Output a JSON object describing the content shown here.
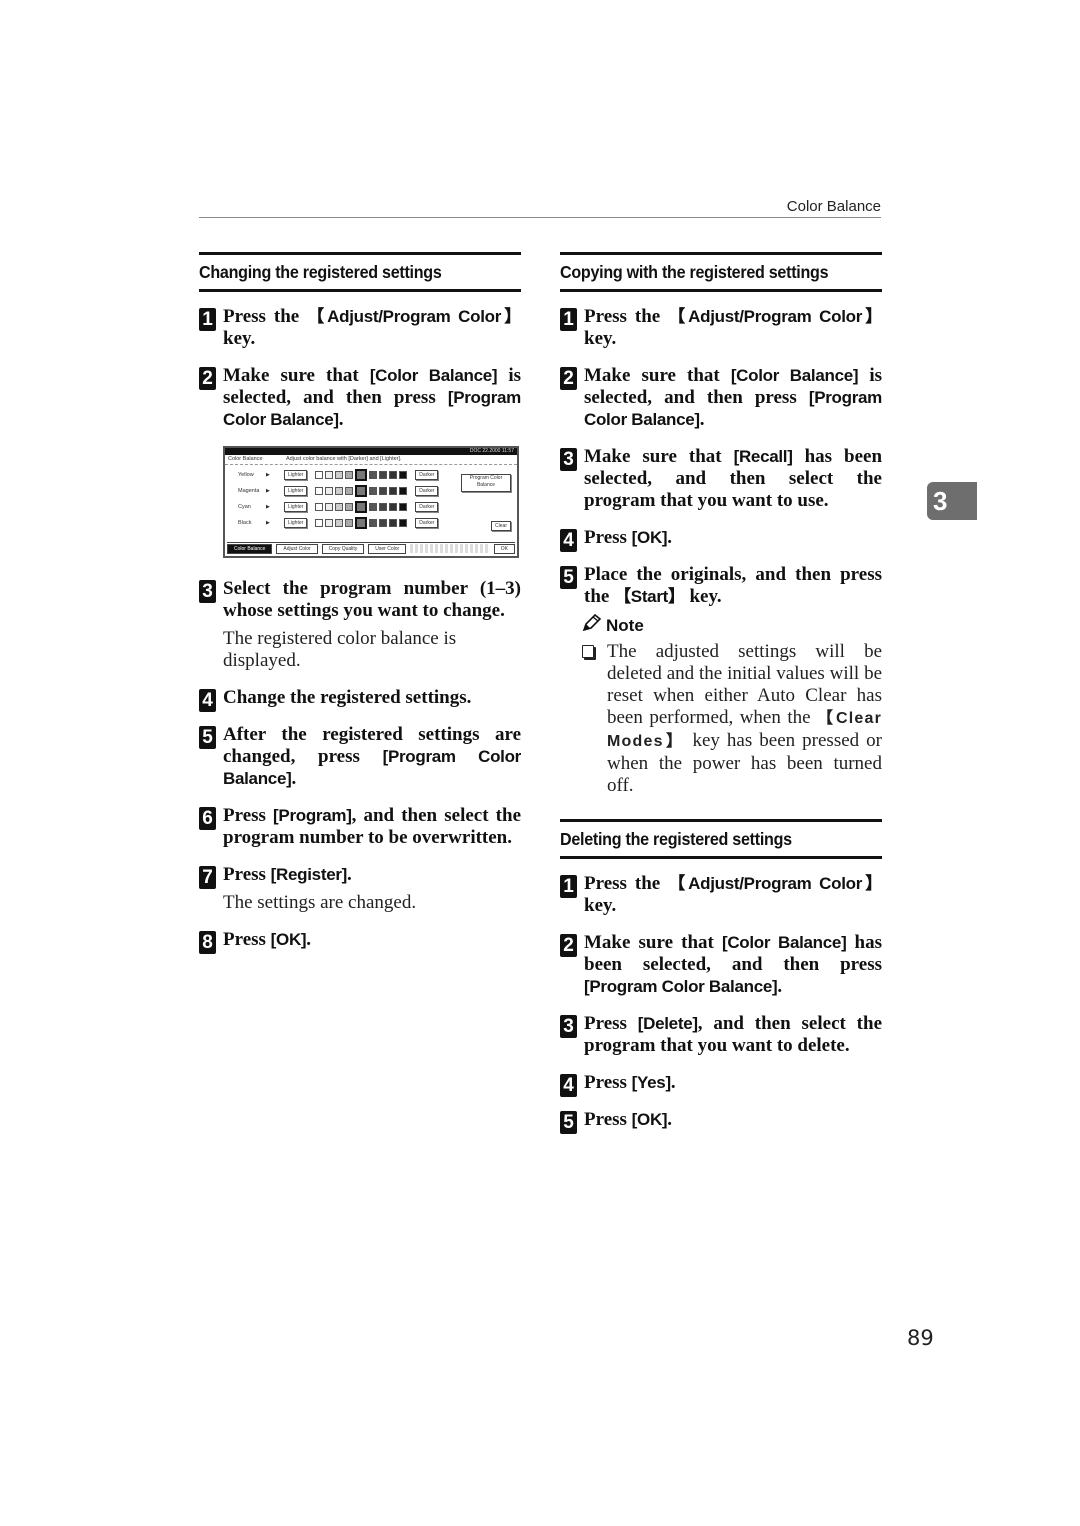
{
  "running_header": "Color Balance",
  "chapter_tab": "3",
  "page_number": "89",
  "left": {
    "heading": "Changing the registered settings",
    "steps": [
      {
        "num": "1",
        "pre": "Press the ",
        "key": "【Adjust/Program Color】",
        "post": " key."
      },
      {
        "num": "2",
        "pre": "Make sure that ",
        "key": "[Color Balance]",
        "mid": " is selected, and then press ",
        "key2": "[Program Color Balance]",
        "post": "."
      },
      {
        "num": "3",
        "text": "Select the program number (1–3) whose settings you want to change.",
        "sub": "The registered color balance is displayed."
      },
      {
        "num": "4",
        "text": "Change the registered settings."
      },
      {
        "num": "5",
        "pre": "After the registered settings are changed, press ",
        "key": "[Program Color Balance]",
        "post": "."
      },
      {
        "num": "6",
        "pre": "Press ",
        "key": "[Program]",
        "post": ", and then select the program number to be overwritten."
      },
      {
        "num": "7",
        "pre": "Press ",
        "key": "[Register]",
        "post": ".",
        "sub": "The settings are changed."
      },
      {
        "num": "8",
        "pre": "Press ",
        "key": "[OK]",
        "post": "."
      }
    ]
  },
  "screen": {
    "status": "DOC 22.2000 11:57",
    "title": "Color Balance",
    "instruction": "Adjust color balance with [Darker] and [Lighter].",
    "rows": [
      {
        "label": "Yellow",
        "lighter": "Lighter",
        "darker": "Darker"
      },
      {
        "label": "Magenta",
        "lighter": "Lighter",
        "darker": "Darker"
      },
      {
        "label": "Cyan",
        "lighter": "Lighter",
        "darker": "Darker"
      },
      {
        "label": "Black",
        "lighter": "Lighter",
        "darker": "Darker"
      }
    ],
    "program_button": "Program Color Balance",
    "clear_button": "Clear",
    "tabs": [
      "Color Balance",
      "Adjust Color",
      "Copy Quality",
      "User Color"
    ],
    "ok_button": "OK"
  },
  "right": {
    "heading": "Copying with the registered settings",
    "steps": [
      {
        "num": "1",
        "pre": "Press the ",
        "key": "【Adjust/Program Color】",
        "post": " key."
      },
      {
        "num": "2",
        "pre": "Make sure that ",
        "key": "[Color Balance]",
        "mid": " is selected, and then press ",
        "key2": "[Program Color Balance]",
        "post": "."
      },
      {
        "num": "3",
        "pre": "Make sure that ",
        "key": "[Recall]",
        "post": " has been selected, and then select the program that you want to use."
      },
      {
        "num": "4",
        "pre": "Press ",
        "key": "[OK]",
        "post": "."
      },
      {
        "num": "5",
        "pre": "Place the originals, and then press the ",
        "key": "【Start】",
        "post": " key."
      }
    ],
    "note": {
      "title": "Note",
      "pre": "The adjusted settings will be deleted and the initial values will be reset when either Auto Clear has been performed, when the ",
      "key": "【Clear Modes】",
      "post": " key has been pressed or when the power has been turned off."
    },
    "heading2": "Deleting the registered settings",
    "steps2": [
      {
        "num": "1",
        "pre": "Press the ",
        "key": "【Adjust/Program Color】",
        "post": " key."
      },
      {
        "num": "2",
        "pre": "Make sure that ",
        "key": "[Color Balance]",
        "mid": " has been selected, and then press ",
        "key2": "[Program Color Balance]",
        "post": "."
      },
      {
        "num": "3",
        "pre": "Press ",
        "key": "[Delete]",
        "post": ", and then select the program that you want to delete."
      },
      {
        "num": "4",
        "pre": "Press ",
        "key": "[Yes]",
        "post": "."
      },
      {
        "num": "5",
        "pre": "Press ",
        "key": "[OK]",
        "post": "."
      }
    ]
  }
}
